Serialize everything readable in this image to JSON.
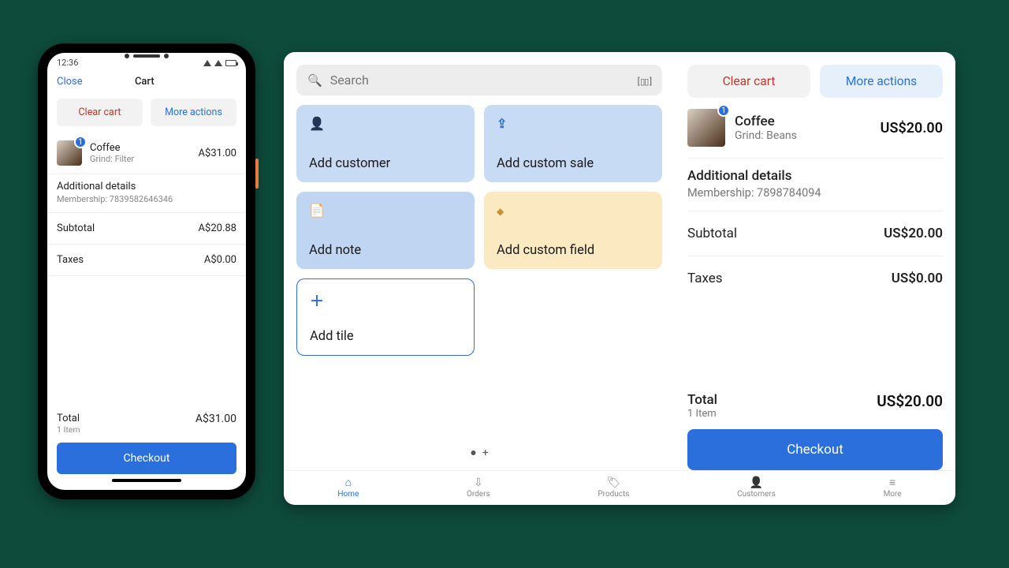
{
  "phone": {
    "status": {
      "time": "12:36"
    },
    "nav": {
      "close": "Close",
      "title": "Cart"
    },
    "buttons": {
      "clear": "Clear cart",
      "more": "More actions"
    },
    "item": {
      "badge": "1",
      "name": "Coffee",
      "variant": "Grind: Filter",
      "price": "A$31.00"
    },
    "details": {
      "heading": "Additional details",
      "membership_label": "Membership: 7839582646346"
    },
    "subtotal": {
      "label": "Subtotal",
      "value": "A$20.88"
    },
    "taxes": {
      "label": "Taxes",
      "value": "A$0.00"
    },
    "total": {
      "label": "Total",
      "items": "1 Item",
      "value": "A$31.00"
    },
    "checkout": "Checkout"
  },
  "tablet": {
    "search_placeholder": "Search",
    "tiles": {
      "add_customer": "Add customer",
      "add_sale": "Add custom sale",
      "add_note": "Add note",
      "add_field": "Add custom field",
      "add_tile": "Add tile"
    },
    "right": {
      "clear": "Clear cart",
      "more": "More actions",
      "item": {
        "badge": "1",
        "name": "Coffee",
        "variant": "Grind: Beans",
        "price": "US$20.00"
      },
      "details": {
        "heading": "Additional details",
        "membership_label": "Membership: 7898784094"
      },
      "subtotal": {
        "label": "Subtotal",
        "value": "US$20.00"
      },
      "taxes": {
        "label": "Taxes",
        "value": "US$0.00"
      },
      "total": {
        "label": "Total",
        "items": "1 Item",
        "value": "US$20.00"
      },
      "checkout": "Checkout"
    },
    "tabs": {
      "home": "Home",
      "orders": "Orders",
      "products": "Products",
      "customers": "Customers",
      "more": "More"
    }
  }
}
